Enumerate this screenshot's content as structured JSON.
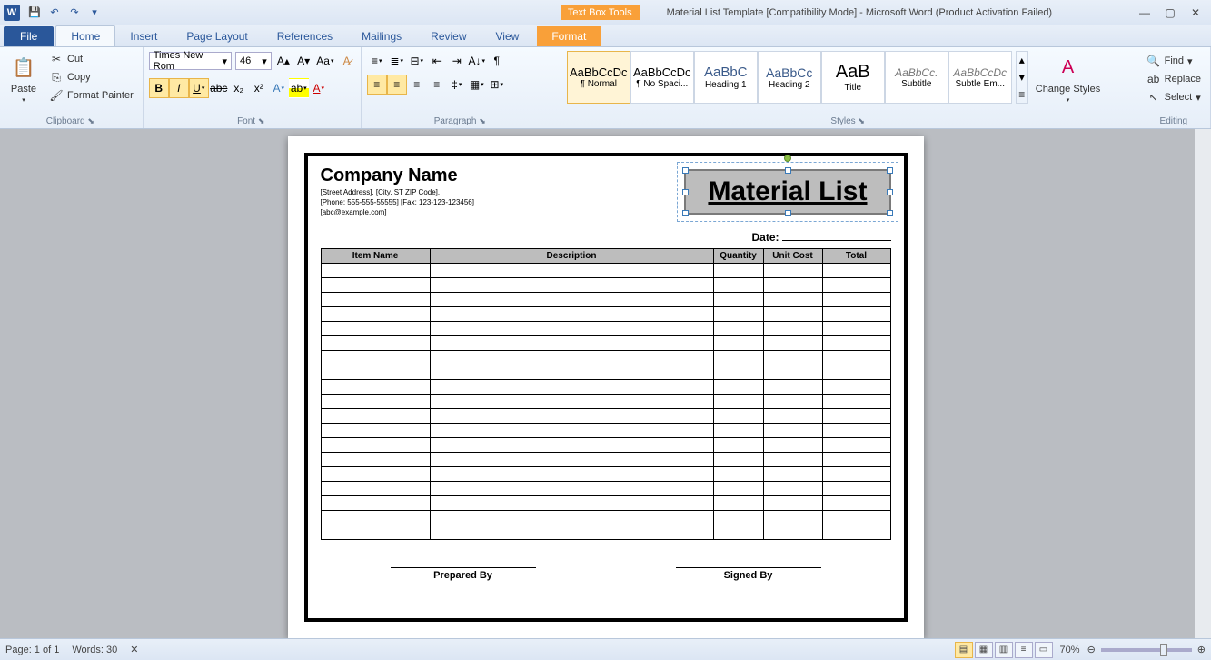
{
  "titlebar": {
    "textbox_tools": "Text Box Tools",
    "doc_title": "Material List Template [Compatibility Mode] - Microsoft Word (Product Activation Failed)"
  },
  "tabs": {
    "file": "File",
    "home": "Home",
    "insert": "Insert",
    "page_layout": "Page Layout",
    "references": "References",
    "mailings": "Mailings",
    "review": "Review",
    "view": "View",
    "format": "Format"
  },
  "ribbon": {
    "clipboard": {
      "label": "Clipboard",
      "paste": "Paste",
      "cut": "Cut",
      "copy": "Copy",
      "format_painter": "Format Painter"
    },
    "font": {
      "label": "Font",
      "name": "Times New Rom",
      "size": "46"
    },
    "paragraph": {
      "label": "Paragraph"
    },
    "styles": {
      "label": "Styles",
      "items": [
        {
          "preview": "AaBbCcDc",
          "name": "¶ Normal"
        },
        {
          "preview": "AaBbCcDc",
          "name": "¶ No Spaci..."
        },
        {
          "preview": "AaBbC",
          "name": "Heading 1"
        },
        {
          "preview": "AaBbCc",
          "name": "Heading 2"
        },
        {
          "preview": "AaB",
          "name": "Title"
        },
        {
          "preview": "AaBbCc.",
          "name": "Subtitle"
        },
        {
          "preview": "AaBbCcDc",
          "name": "Subtle Em..."
        }
      ],
      "change": "Change Styles"
    },
    "editing": {
      "label": "Editing",
      "find": "Find",
      "replace": "Replace",
      "select": "Select"
    }
  },
  "doc": {
    "company": "Company Name",
    "addr": "[Street Address], [City, ST ZIP Code].",
    "phone": "[Phone: 555-555-55555] [Fax: 123-123-123456]",
    "email": "[abc@example.com]",
    "material_title": "Material List",
    "date_label": "Date:",
    "columns": [
      "Item Name",
      "Description",
      "Quantity",
      "Unit Cost",
      "Total"
    ],
    "rows": 19,
    "prepared": "Prepared By",
    "signed": "Signed By"
  },
  "status": {
    "page": "Page: 1 of 1",
    "words": "Words: 30",
    "zoom": "70%"
  }
}
